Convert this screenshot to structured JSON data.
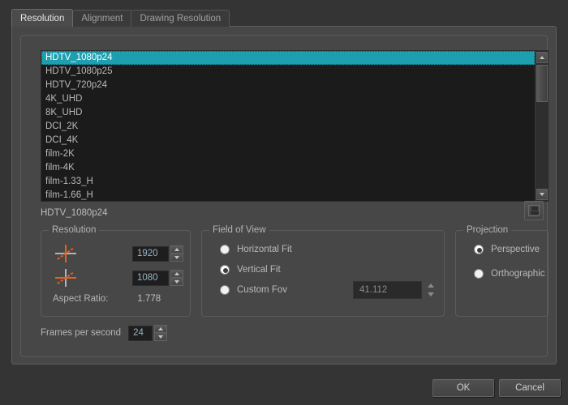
{
  "tabs": [
    {
      "label": "Resolution",
      "active": true
    },
    {
      "label": "Alignment",
      "active": false
    },
    {
      "label": "Drawing Resolution",
      "active": false
    }
  ],
  "presets": {
    "items": [
      "HDTV_1080p24",
      "HDTV_1080p25",
      "HDTV_720p24",
      "4K_UHD",
      "8K_UHD",
      "DCI_2K",
      "DCI_4K",
      "film-2K",
      "film-4K",
      "film-1.33_H",
      "film-1.66_H"
    ],
    "selected_index": 0,
    "current_label": "HDTV_1080p24"
  },
  "save_button": {
    "icon": "floppy-disk-icon"
  },
  "resolution": {
    "group_label": "Resolution",
    "width_icon": "horizontal-dimension-icon",
    "height_icon": "vertical-dimension-icon",
    "width_value": "1920",
    "height_value": "1080",
    "aspect_label": "Aspect Ratio:",
    "aspect_value": "1.778"
  },
  "field_of_view": {
    "group_label": "Field of View",
    "options": [
      {
        "label": "Horizontal Fit",
        "checked": false
      },
      {
        "label": "Vertical Fit",
        "checked": true
      },
      {
        "label": "Custom Fov",
        "checked": false
      }
    ],
    "custom_value": "41.112"
  },
  "projection": {
    "group_label": "Projection",
    "options": [
      {
        "label": "Perspective",
        "checked": true
      },
      {
        "label": "Orthographic",
        "checked": false
      }
    ]
  },
  "frames_per_second": {
    "label": "Frames per second",
    "value": "24"
  },
  "buttons": {
    "ok": "OK",
    "cancel": "Cancel"
  },
  "colors": {
    "window_bg": "#343434",
    "panel_bg": "#474747",
    "list_bg": "#1b1b1b",
    "selection": "#1d9fb0",
    "accent_orange": "#e8601f",
    "field_bg": "#1e1e1e",
    "field_text": "#9ab4c8"
  }
}
